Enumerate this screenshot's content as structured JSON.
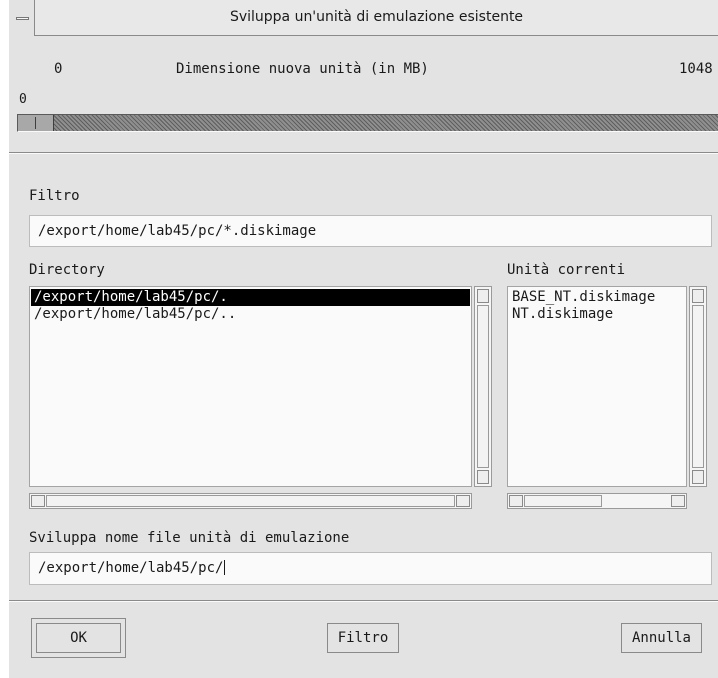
{
  "window": {
    "title": "Sviluppa un'unità di emulazione esistente"
  },
  "scale": {
    "min_label": "0",
    "label": "Dimensione nuova unità (in MB)",
    "max_label": "1048",
    "value_label": "0",
    "value": 0
  },
  "filter": {
    "label": "Filtro",
    "value": "/export/home/lab45/pc/*.diskimage"
  },
  "directory": {
    "label": "Directory",
    "items": [
      "/export/home/lab45/pc/.",
      "/export/home/lab45/pc/.."
    ]
  },
  "units": {
    "label": "Unità correnti",
    "items": [
      "BASE_NT.diskimage",
      "NT.diskimage"
    ]
  },
  "filename": {
    "label": "Sviluppa nome file unità di emulazione",
    "value": "/export/home/lab45/pc/"
  },
  "buttons": {
    "ok": "OK",
    "filter": "Filtro",
    "cancel": "Annulla"
  }
}
